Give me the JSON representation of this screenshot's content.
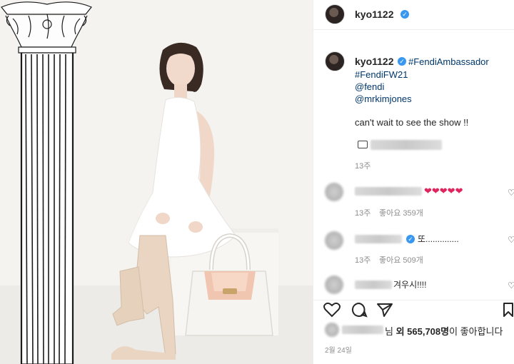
{
  "post": {
    "username": "kyo1122",
    "caption": {
      "hashtag1": "#FendiAmbassador",
      "hashtag2": "#FendiFW21",
      "mention1": "@fendi",
      "mention2": "@mrkimjones",
      "body": "can't wait to see the show !!"
    },
    "caption_time": "13주"
  },
  "comments": [
    {
      "hearts": "❤❤❤❤❤",
      "time": "13주",
      "likes": "좋아요 359개"
    },
    {
      "text": "또..............",
      "time": "13주",
      "likes": "좋아요 509개"
    },
    {
      "text": "겨우시!!!!"
    }
  ],
  "likes_line": {
    "suffix1": "님 ",
    "bold1": "외 565,708명",
    "suffix2": "이 좋아합니다"
  },
  "date": "2월 24일",
  "colors": {
    "link": "#00376b",
    "verified": "#3897f0",
    "heart": "#e0245e"
  },
  "icons": [
    "heart-icon",
    "comment-icon",
    "share-icon",
    "bookmark-icon",
    "verified-icon"
  ]
}
